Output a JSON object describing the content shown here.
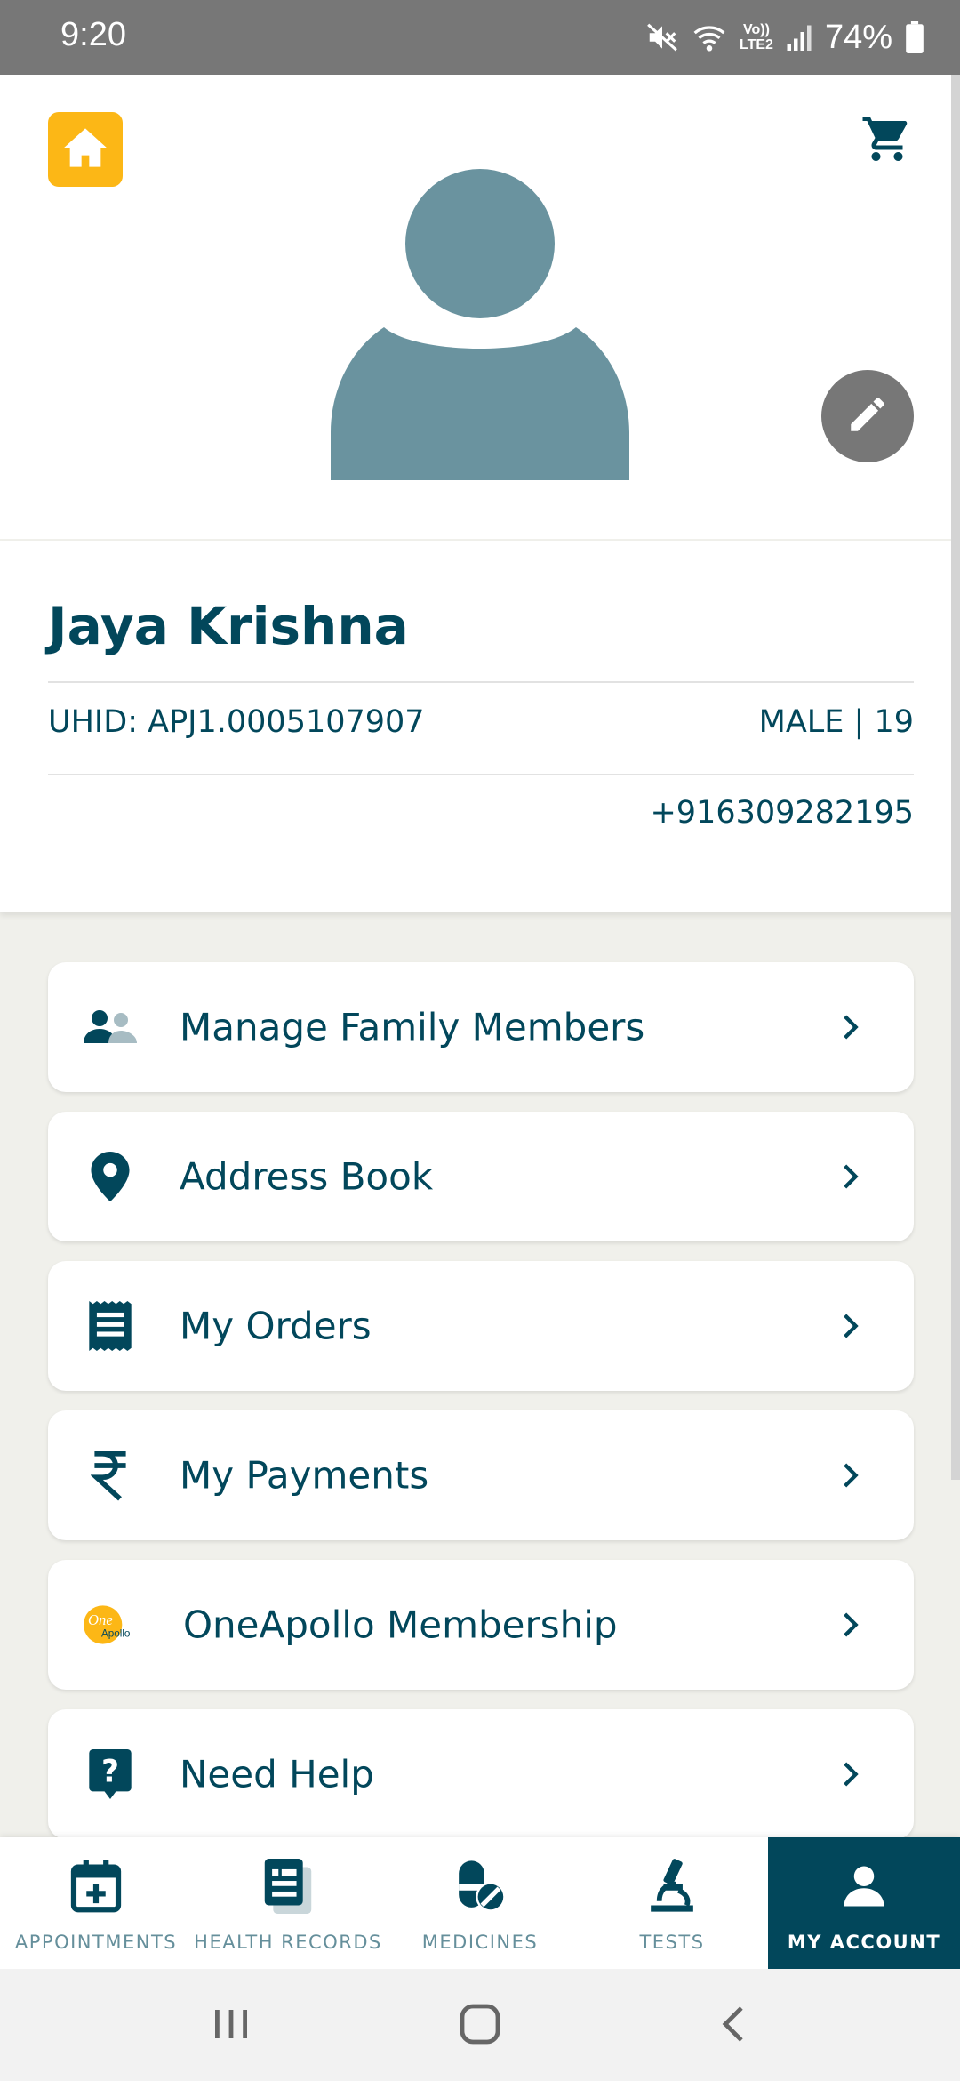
{
  "status_bar": {
    "time": "9:20",
    "battery_percent": "74%",
    "network_label_top": "Vo))",
    "network_label_bottom": "LTE2",
    "icons": [
      "mute-icon",
      "wifi-icon",
      "signal-icon",
      "battery-icon"
    ]
  },
  "header": {
    "home_icon": "home-icon",
    "cart_icon": "cart-icon",
    "edit_icon": "pencil-icon"
  },
  "profile": {
    "name": "Jaya Krishna",
    "uhid": "UHID: APJ1.0005107907",
    "gender_age": "MALE | 19",
    "phone": "+916309282195"
  },
  "menu": {
    "items": [
      {
        "label": "Manage Family Members",
        "icon": "family-icon"
      },
      {
        "label": "Address Book",
        "icon": "location-pin-icon"
      },
      {
        "label": "My Orders",
        "icon": "receipt-icon"
      },
      {
        "label": "My Payments",
        "icon": "rupee-icon"
      },
      {
        "label": "OneApollo Membership",
        "icon": "oneapollo-logo-icon",
        "logo_text_top": "One",
        "logo_text_bottom": "Apollo"
      },
      {
        "label": "Need Help",
        "icon": "help-icon"
      }
    ]
  },
  "bottom_nav": {
    "tabs": [
      {
        "label": "APPOINTMENTS",
        "icon": "calendar-add-icon",
        "active": false
      },
      {
        "label": "HEALTH RECORDS",
        "icon": "health-records-icon",
        "active": false
      },
      {
        "label": "MEDICINES",
        "icon": "medicines-icon",
        "active": false
      },
      {
        "label": "TESTS",
        "icon": "microscope-icon",
        "active": false
      },
      {
        "label": "MY ACCOUNT",
        "icon": "account-icon",
        "active": true
      }
    ]
  },
  "colors": {
    "primary": "#02475b",
    "accent": "#fcb716",
    "avatar": "#6a939f",
    "muted_nav": "#658f9b"
  }
}
